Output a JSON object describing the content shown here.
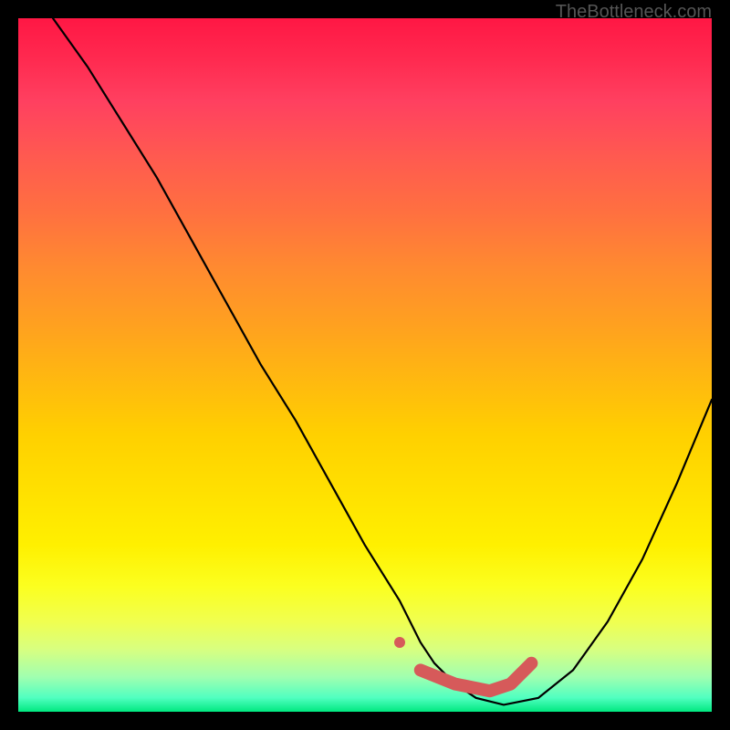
{
  "watermark": "TheBottleneck.com",
  "chart_data": {
    "type": "line",
    "title": "",
    "xlabel": "",
    "ylabel": "",
    "xlim": [
      0,
      100
    ],
    "ylim": [
      0,
      100
    ],
    "series": [
      {
        "name": "bottleneck-curve",
        "color": "#000000",
        "x": [
          5,
          10,
          15,
          20,
          25,
          30,
          35,
          40,
          45,
          50,
          55,
          58,
          60,
          63,
          66,
          70,
          75,
          80,
          85,
          90,
          95,
          100
        ],
        "y": [
          100,
          93,
          85,
          77,
          68,
          59,
          50,
          42,
          33,
          24,
          16,
          10,
          7,
          4,
          2,
          1,
          2,
          6,
          13,
          22,
          33,
          45
        ]
      },
      {
        "name": "optimal-marker",
        "color": "#d65a5a",
        "type": "marker-path",
        "points": [
          {
            "x": 55,
            "y": 10,
            "kind": "dot"
          },
          {
            "x": 58,
            "y": 6,
            "kind": "path-start"
          },
          {
            "x": 63,
            "y": 4,
            "kind": "path"
          },
          {
            "x": 68,
            "y": 3,
            "kind": "path"
          },
          {
            "x": 71,
            "y": 4,
            "kind": "path"
          },
          {
            "x": 74,
            "y": 7,
            "kind": "path-end"
          }
        ]
      }
    ],
    "background": {
      "gradient": "vertical",
      "stops": [
        {
          "pos": 0,
          "color": "#ff1744"
        },
        {
          "pos": 0.5,
          "color": "#ffd000"
        },
        {
          "pos": 0.85,
          "color": "#fbff20"
        },
        {
          "pos": 1.0,
          "color": "#00e880"
        }
      ]
    }
  }
}
